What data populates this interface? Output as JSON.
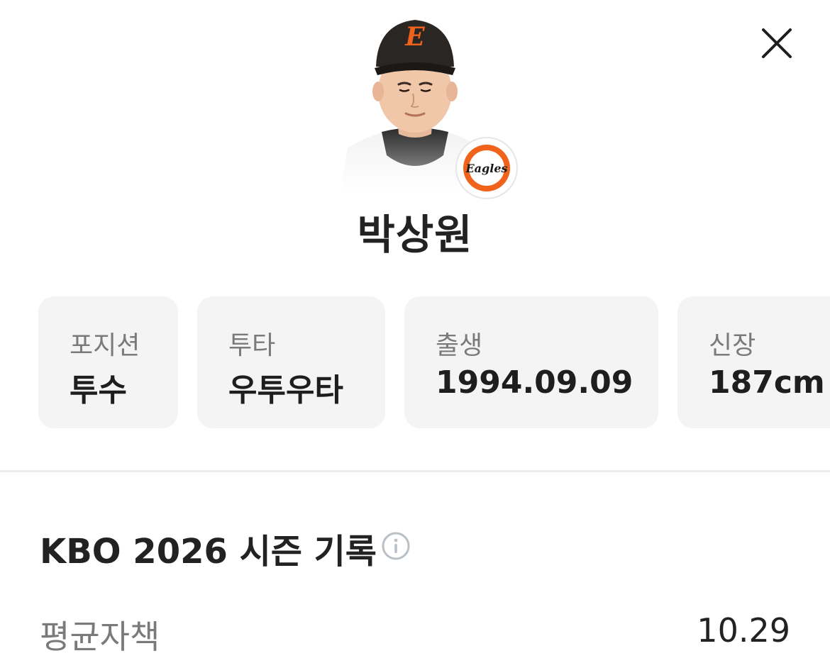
{
  "header": {
    "close_icon": "close-icon"
  },
  "player": {
    "name": "박상원",
    "team_logo_text": "Eagles",
    "cap_letter": "E",
    "team_color": "#f0631d"
  },
  "info_cards": [
    {
      "label": "포지션",
      "value": "투수"
    },
    {
      "label": "투타",
      "value": "우투우타"
    },
    {
      "label": "출생",
      "value": "1994.09.09"
    },
    {
      "label": "신장",
      "value": "187cm"
    }
  ],
  "season": {
    "title": "KBO 2026 시즌 기록",
    "info_icon": "info-icon",
    "stats": [
      {
        "label": "평균자책",
        "value": "10.29"
      }
    ]
  }
}
